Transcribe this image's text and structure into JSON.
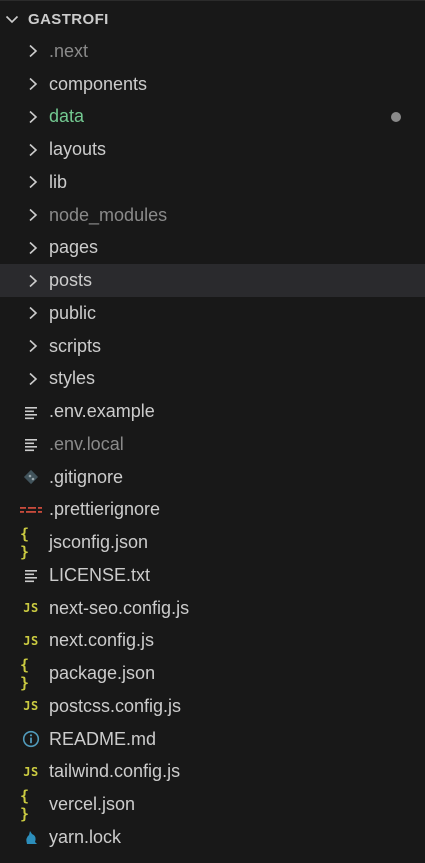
{
  "explorer": {
    "title": "GASTROFI",
    "colors": {
      "background": "#181818",
      "selected_row": "#2a2a2d",
      "folder_text": "#cccccc",
      "ignored_text": "#8a8a8a",
      "modified_text": "#73c991",
      "js_icon": "#cbcb41",
      "json_icon": "#cbcb41",
      "info_icon": "#519aba",
      "yarn_icon": "#2c8ebb",
      "prettier_icon": "#c94b3c"
    },
    "folders": [
      {
        "label": ".next",
        "state": "ignored"
      },
      {
        "label": "components",
        "state": "normal"
      },
      {
        "label": "data",
        "state": "modified"
      },
      {
        "label": "layouts",
        "state": "normal"
      },
      {
        "label": "lib",
        "state": "normal"
      },
      {
        "label": "node_modules",
        "state": "ignored"
      },
      {
        "label": "pages",
        "state": "normal"
      },
      {
        "label": "posts",
        "state": "selected"
      },
      {
        "label": "public",
        "state": "normal"
      },
      {
        "label": "scripts",
        "state": "normal"
      },
      {
        "label": "styles",
        "state": "normal"
      }
    ],
    "files": [
      {
        "label": ".env.example",
        "icon": "text-lines-icon",
        "state": "normal"
      },
      {
        "label": ".env.local",
        "icon": "text-lines-icon",
        "state": "ignored"
      },
      {
        "label": ".gitignore",
        "icon": "git-diamond-icon",
        "state": "normal"
      },
      {
        "label": ".prettierignore",
        "icon": "prettier-icon",
        "state": "normal"
      },
      {
        "label": "jsconfig.json",
        "icon": "json-braces-icon",
        "state": "normal",
        "icon_text": "{ }"
      },
      {
        "label": "LICENSE.txt",
        "icon": "text-lines-icon",
        "state": "normal"
      },
      {
        "label": "next-seo.config.js",
        "icon": "js-icon",
        "state": "normal",
        "icon_text": "JS"
      },
      {
        "label": "next.config.js",
        "icon": "js-icon",
        "state": "normal",
        "icon_text": "JS"
      },
      {
        "label": "package.json",
        "icon": "json-braces-icon",
        "state": "normal",
        "icon_text": "{ }"
      },
      {
        "label": "postcss.config.js",
        "icon": "js-icon",
        "state": "normal",
        "icon_text": "JS"
      },
      {
        "label": "README.md",
        "icon": "info-circle-icon",
        "state": "normal"
      },
      {
        "label": "tailwind.config.js",
        "icon": "js-icon",
        "state": "normal",
        "icon_text": "JS"
      },
      {
        "label": "vercel.json",
        "icon": "json-braces-icon",
        "state": "normal",
        "icon_text": "{ }"
      },
      {
        "label": "yarn.lock",
        "icon": "yarn-cat-icon",
        "state": "normal"
      }
    ]
  }
}
